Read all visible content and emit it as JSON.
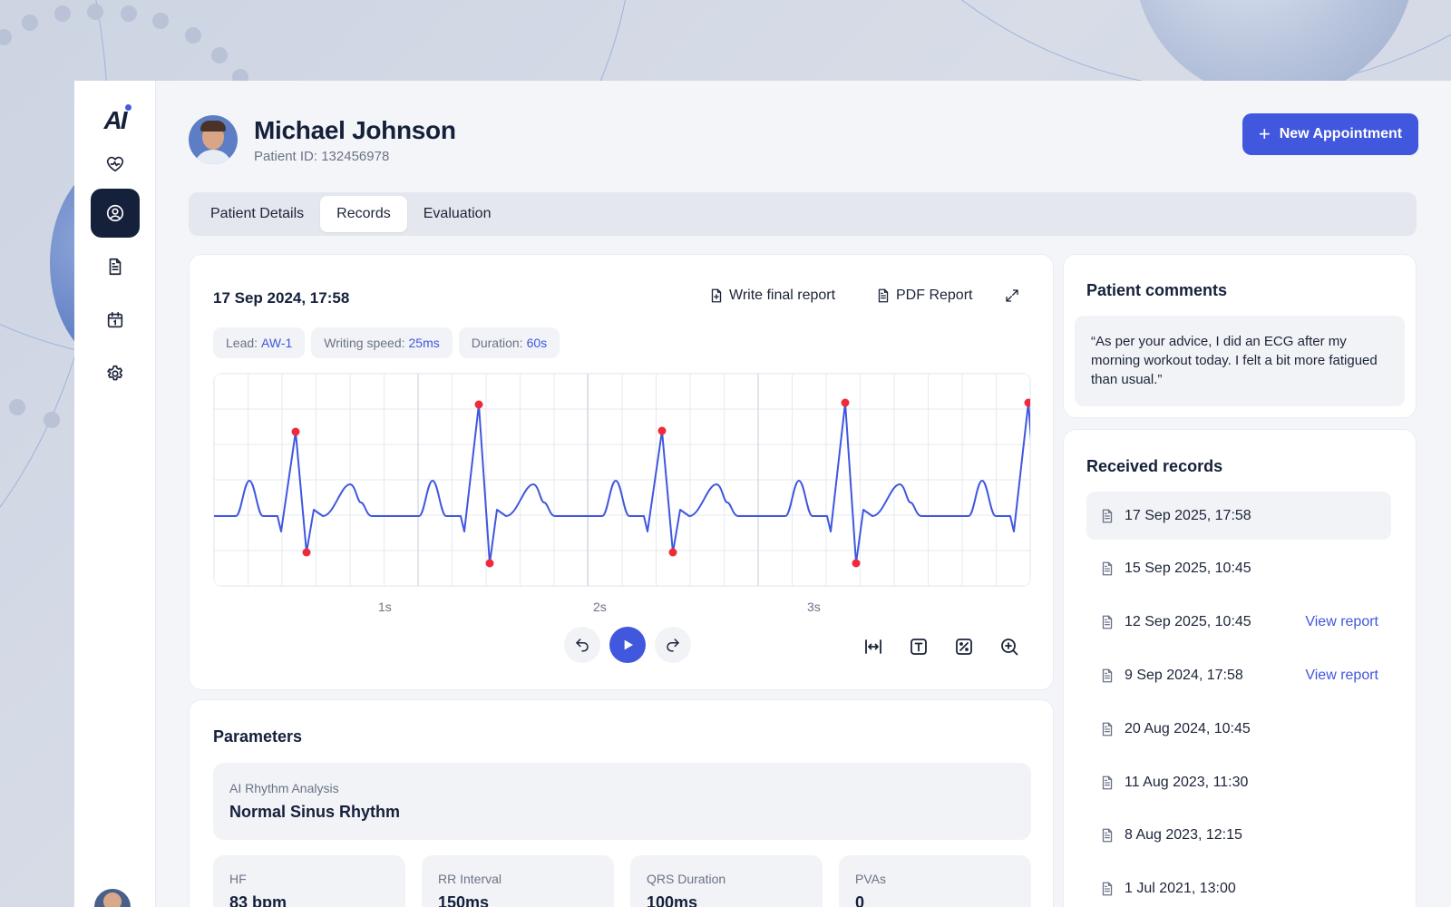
{
  "brand": {
    "logo_text": "AI"
  },
  "patient": {
    "name": "Michael Johnson",
    "id_text": "Patient ID: 132456978"
  },
  "header": {
    "new_appointment_label": "New Appointment"
  },
  "tabs": [
    {
      "label": "Patient Details",
      "active": false
    },
    {
      "label": "Records",
      "active": true
    },
    {
      "label": "Evaluation",
      "active": false
    }
  ],
  "ecg": {
    "date": "17 Sep 2024, 17:58",
    "write_report_label": "Write final report",
    "pdf_report_label": "PDF Report",
    "chips": [
      {
        "label": "Lead:",
        "value": "AW-1"
      },
      {
        "label": "Writing speed:",
        "value": "25ms"
      },
      {
        "label": "Duration:",
        "value": "60s"
      }
    ],
    "time_labels": [
      "1s",
      "2s",
      "3s"
    ],
    "colors": {
      "trace": "#4057de",
      "peak_marker": "#ef2b3a",
      "grid": "#e6e9f0"
    }
  },
  "parameters": {
    "title": "Parameters",
    "ai_label": "AI Rhythm Analysis",
    "ai_value": "Normal Sinus Rhythm",
    "metrics": [
      {
        "label": "HF",
        "value": "83 bpm"
      },
      {
        "label": "RR Interval",
        "value": "150ms"
      },
      {
        "label": "QRS Duration",
        "value": "100ms"
      },
      {
        "label": "PVAs",
        "value": "0"
      }
    ]
  },
  "comments": {
    "title": "Patient comments",
    "text": "“As per your advice, I did an ECG after my morning workout today. I felt a bit more fatigued than usual.”"
  },
  "records": {
    "title": "Received records",
    "items": [
      {
        "date": "17 Sep 2025, 17:58",
        "link": "",
        "selected": true
      },
      {
        "date": "15 Sep 2025, 10:45",
        "link": ""
      },
      {
        "date": "12 Sep 2025, 10:45",
        "link": "View report"
      },
      {
        "date": "9 Sep 2024, 17:58",
        "link": "View report"
      },
      {
        "date": "20 Aug 2024, 10:45",
        "link": ""
      },
      {
        "date": "11 Aug 2023, 11:30",
        "link": ""
      },
      {
        "date": "8 Aug 2023, 12:15",
        "link": ""
      },
      {
        "date": "1 Jul 2021, 13:00",
        "link": ""
      }
    ]
  },
  "colors": {
    "accent": "#4057de",
    "dark": "#15203a",
    "muted": "#6b7386"
  }
}
